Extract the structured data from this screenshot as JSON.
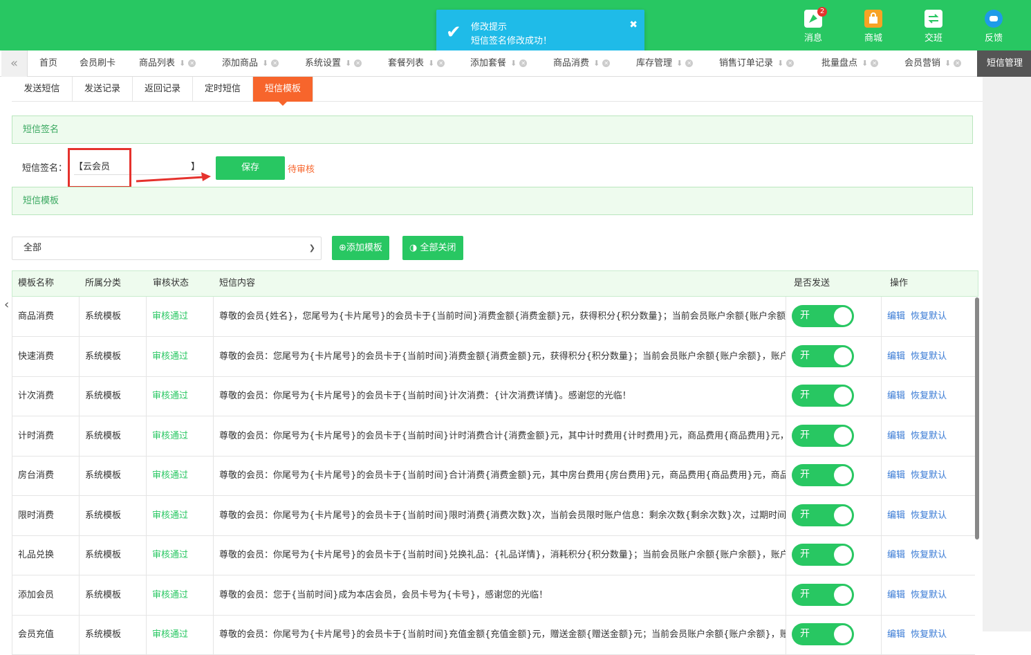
{
  "header": {
    "buttons": [
      {
        "label": "消息",
        "icon": "rocket-icon",
        "badge": "2"
      },
      {
        "label": "商城",
        "icon": "shop-icon"
      },
      {
        "label": "交班",
        "icon": "exchange-icon"
      },
      {
        "label": "反馈",
        "icon": "chat-icon"
      }
    ]
  },
  "toast": {
    "title": "修改提示",
    "message": "短信签名修改成功！",
    "close": "✖"
  },
  "tabs": [
    "首页",
    "会员刷卡",
    "商品列表",
    "添加商品",
    "系统设置",
    "套餐列表",
    "添加套餐",
    "商品消费",
    "库存管理",
    "销售订单记录",
    "批量盘点",
    "会员营销",
    "短信管理"
  ],
  "subtabs": [
    "发送短信",
    "发送记录",
    "返回记录",
    "定时短信",
    "短信模板"
  ],
  "signature": {
    "panel_title": "短信签名",
    "label": "短信签名：",
    "left_bracket": "【",
    "value": "云会员",
    "right_bracket": "】",
    "save": "保存",
    "status": "待审核"
  },
  "template_panel_title": "短信模板",
  "filter": {
    "selected": "全部",
    "add_button": "添加模板",
    "close_all_button": "全部关闭"
  },
  "table": {
    "headers": [
      "模板名称",
      "所属分类",
      "审核状态",
      "短信内容",
      "是否发送",
      "操作"
    ],
    "rows": [
      {
        "name": "商品消费",
        "category": "系统模板",
        "status": "审核通过",
        "content": "尊敬的会员{姓名}，您尾号为{卡片尾号}的会员卡于{当前时间}消费金额{消费金额}元，获得积分{积分数量}；当前会员账户余额{账户余额}，账户",
        "toggle": "开"
      },
      {
        "name": "快速消费",
        "category": "系统模板",
        "status": "审核通过",
        "content": "尊敬的会员：您尾号为{卡片尾号}的会员卡于{当前时间}消费金额{消费金额}元，获得积分{积分数量}；当前会员账户余额{账户余额}，账户积分{",
        "toggle": "开"
      },
      {
        "name": "计次消费",
        "category": "系统模板",
        "status": "审核通过",
        "content": "尊敬的会员：你尾号为{卡片尾号}的会员卡于{当前时间}计次消费：{计次消费详情}。感谢您的光临！",
        "toggle": "开"
      },
      {
        "name": "计时消费",
        "category": "系统模板",
        "status": "审核通过",
        "content": "尊敬的会员：你尾号为{卡片尾号}的会员卡于{当前时间}计时消费合计{消费金额}元，其中计时费用{计时费用}元，商品费用{商品费用}元，商品i",
        "toggle": "开"
      },
      {
        "name": "房台消费",
        "category": "系统模板",
        "status": "审核通过",
        "content": "尊敬的会员：你尾号为{卡片尾号}的会员卡于{当前时间}合计消费{消费金额}元，其中房台费用{房台费用}元，商品费用{商品费用}元，商品详情{",
        "toggle": "开"
      },
      {
        "name": "限时消费",
        "category": "系统模板",
        "status": "审核通过",
        "content": "尊敬的会员：你尾号为{卡片尾号}的会员卡于{当前时间}限时消费{消费次数}次，当前会员限时账户信息：剩余次数{剩余次数}次，过期时间{过期",
        "toggle": "开"
      },
      {
        "name": "礼品兑换",
        "category": "系统模板",
        "status": "审核通过",
        "content": "尊敬的会员：你尾号为{卡片尾号}的会员卡于{当前时间}兑换礼品：{礼品详情}，消耗积分{积分数量}；当前会员账户余额{账户余额}，账户积分{",
        "toggle": "开"
      },
      {
        "name": "添加会员",
        "category": "系统模板",
        "status": "审核通过",
        "content": "尊敬的会员：您于{当前时间}成为本店会员，会员卡号为{卡号}，感谢您的光临！",
        "toggle": "开"
      },
      {
        "name": "会员充值",
        "category": "系统模板",
        "status": "审核通过",
        "content": "尊敬的会员：你尾号为{卡片尾号}的会员卡于{当前时间}充值金额{充值金额}元，赠送金额{赠送金额}元；当前会员账户余额{账户余额}，账户积分{",
        "toggle": "开"
      }
    ],
    "edit": "编辑",
    "restore": "恢复默认"
  }
}
